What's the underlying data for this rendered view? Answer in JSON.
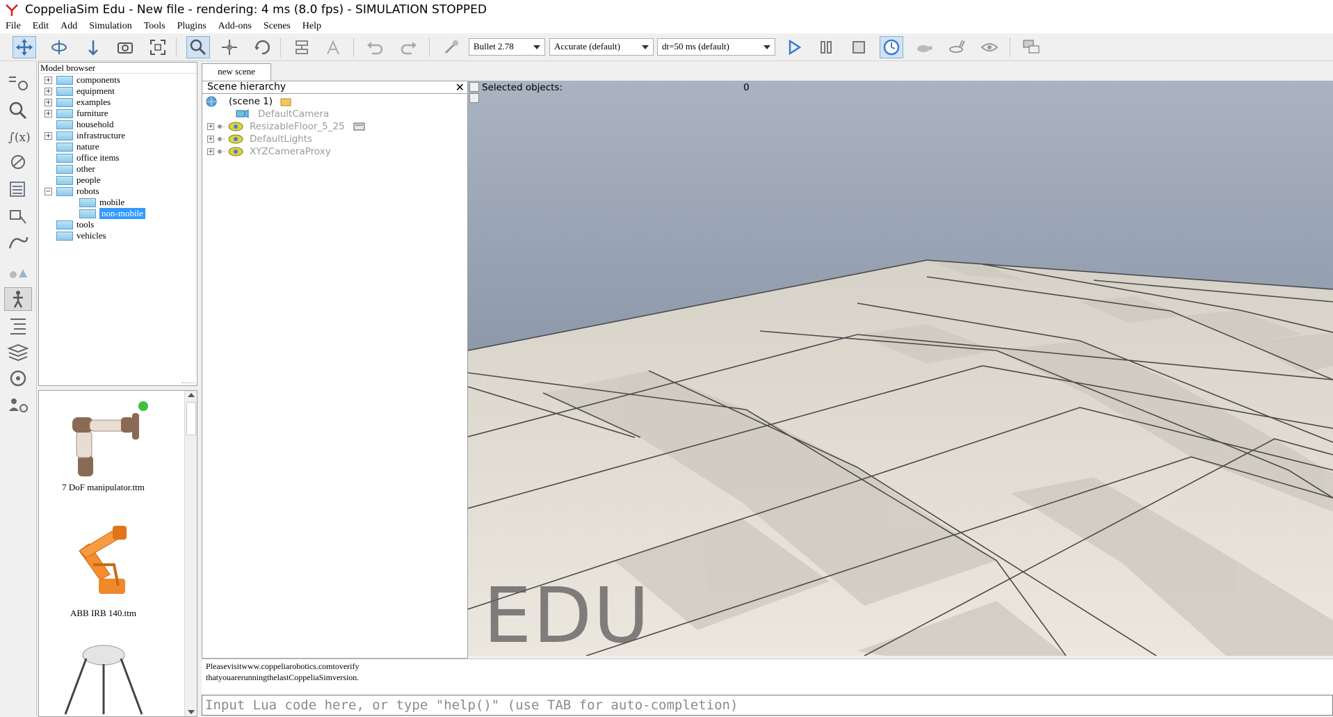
{
  "window": {
    "title": "CoppeliaSim Edu - New file - rendering: 4 ms (8.0 fps) - SIMULATION STOPPED"
  },
  "menubar": {
    "items": [
      "File",
      "Edit",
      "Add",
      "Simulation",
      "Tools",
      "Plugins",
      "Add-ons",
      "Scenes",
      "Help"
    ]
  },
  "toolbar": {
    "physics_engine": "Bullet 2.78",
    "accuracy": "Accurate (default)",
    "timestep": "dt=50 ms (default)",
    "icons": [
      "move-camera-icon",
      "rotate-camera-icon",
      "shift-camera-icon",
      "camera-angle-icon",
      "fit-to-view-icon",
      "select-object-icon",
      "object-shift-icon",
      "object-rotate-icon",
      "assemble-icon",
      "transfer-dna-icon",
      "undo-icon",
      "redo-icon",
      "dynamics-icon",
      "play-icon",
      "pause-icon",
      "stop-icon",
      "realtime-icon",
      "slow-down-icon",
      "speed-up-icon",
      "visualization-toggle-icon",
      "page-selector-icon"
    ]
  },
  "left_toolbar": {
    "icons": [
      "object-properties-icon",
      "calculation-modules-icon",
      "scripts-icon",
      "shapes-edit-icon",
      "layers-icon",
      "selection-icon",
      "path-icon",
      "collection-icon",
      "model-browser-icon",
      "scene-hierarchy-icon",
      "layers-stack-icon",
      "video-recorder-icon",
      "user-settings-icon"
    ]
  },
  "model_browser": {
    "header": "Model browser",
    "items": [
      {
        "label": "components",
        "expander": "+"
      },
      {
        "label": "equipment",
        "expander": "+"
      },
      {
        "label": "examples",
        "expander": "+"
      },
      {
        "label": "furniture",
        "expander": "+"
      },
      {
        "label": "household",
        "expander": ""
      },
      {
        "label": "infrastructure",
        "expander": "+"
      },
      {
        "label": "nature",
        "expander": ""
      },
      {
        "label": "office items",
        "expander": ""
      },
      {
        "label": "other",
        "expander": ""
      },
      {
        "label": "people",
        "expander": ""
      },
      {
        "label": "robots",
        "expander": "−"
      },
      {
        "label": "mobile",
        "expander": ""
      },
      {
        "label": "non-mobile",
        "expander": ""
      },
      {
        "label": "tools",
        "expander": ""
      },
      {
        "label": "vehicles",
        "expander": ""
      }
    ],
    "selected": "non-mobile"
  },
  "thumbnails": [
    {
      "label": "7 DoF manipulator.ttm"
    },
    {
      "label": "ABB IRB 140.ttm"
    }
  ],
  "scene_tab": {
    "label": "new scene"
  },
  "scene_hierarchy": {
    "header": "Scene hierarchy",
    "close": "✕",
    "root": "(scene 1)",
    "objects": [
      "DefaultCamera",
      "ResizableFloor_5_25",
      "DefaultLights",
      "XYZCameraProxy"
    ],
    "expander": "+"
  },
  "viewport": {
    "selected_label": "Selected objects:",
    "selected_count": "0",
    "watermark": "EDU"
  },
  "status": {
    "line1": "Pleasevisitwww.coppeliarobotics.comtoverify",
    "line2": "thatyouarerunningthelastCoppeliaSimversion."
  },
  "console": {
    "placeholder": "Input Lua code here, or type \"help()\" (use TAB for auto-completion)"
  },
  "colors": {
    "accent": "#3399ff",
    "sky_top": "#8c98a9",
    "floor": "#dcd8cf",
    "play_blue": "#3a7bd5"
  }
}
